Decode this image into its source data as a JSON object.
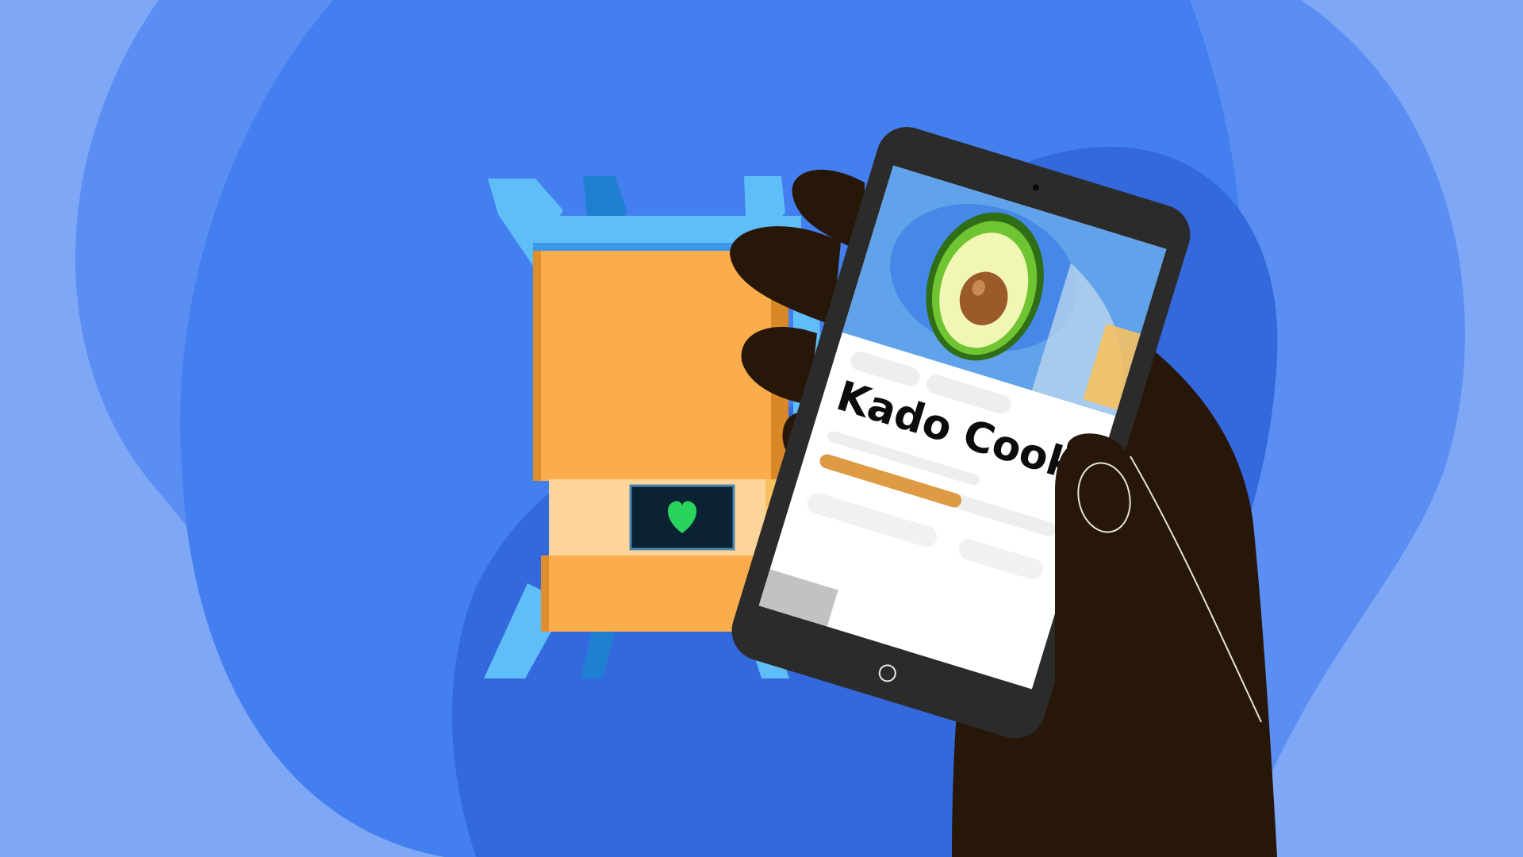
{
  "app": {
    "title": "Kado Cooks"
  },
  "colors": {
    "background_light": "#7ea7f6",
    "background_mid": "#5b8ef2",
    "background_main": "#447fef",
    "background_deep": "#3469dd",
    "box_orange": "#fbac4d",
    "box_flaps": "#5fbdf8",
    "heart": "#2ad35c",
    "phone_frame": "#2b2b2b",
    "hand": "#261709",
    "progress": "#df9a46"
  },
  "illustration": {
    "subject": "hand-holding-tablet",
    "box_icon": "heart-icon",
    "screen_icon": "avocado-icon",
    "progress": 0.6
  }
}
